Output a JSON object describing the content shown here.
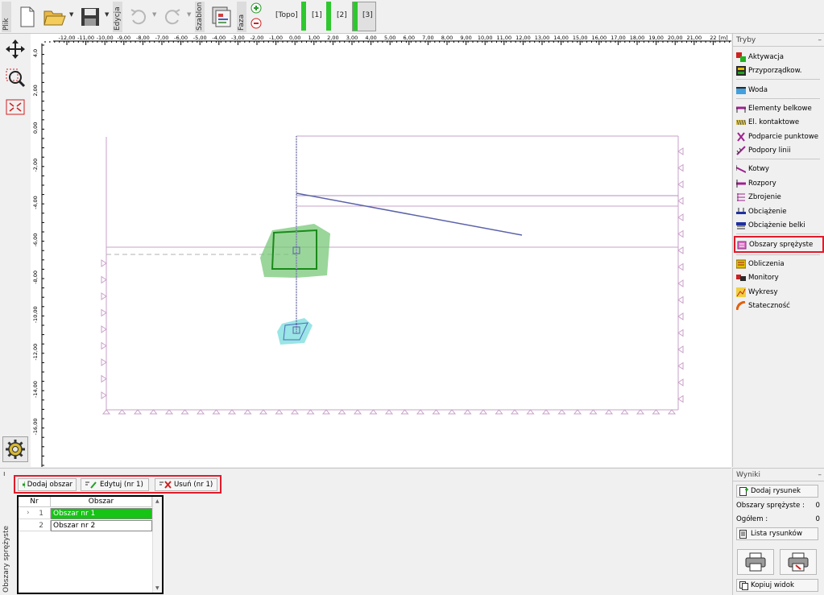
{
  "toolbar": {
    "file_label": "Plik",
    "edit_label": "Edycja",
    "template_label": "Szablon",
    "phase_label": "Faza",
    "phases": [
      "[Topo]",
      "[1]",
      "[2]",
      "[3]"
    ],
    "active_phase": "[3]"
  },
  "ruler": {
    "x_ticks": [
      "-12,00",
      "-11,00",
      "-10,00",
      "-9,00",
      "-8,00",
      "-7,00",
      "-6,00",
      "-5,00",
      "-4,00",
      "-3,00",
      "-2,00",
      "-1,00",
      "0,00",
      "1,00",
      "2,00",
      "3,00",
      "4,00",
      "5,00",
      "6,00",
      "7,00",
      "8,00",
      "9,00",
      "10,00",
      "11,00",
      "12,00",
      "13,00",
      "14,00",
      "15,00",
      "16,00",
      "17,00",
      "18,00",
      "19,00",
      "20,00",
      "21,00",
      "22"
    ],
    "x_unit": "[m]",
    "y_ticks": [
      "4,0",
      "2,00",
      "0,00",
      "-2,00",
      "-4,00",
      "-6,00",
      "-8,00",
      "-10,00",
      "-12,00",
      "-14,00",
      "-16,00"
    ]
  },
  "modes": {
    "title": "Tryby",
    "minimize": "–",
    "items": [
      {
        "label": "Aktywacja",
        "icon": "activation-icon"
      },
      {
        "label": "Przyporządkow.",
        "icon": "assignment-icon"
      },
      {
        "label": "Woda",
        "icon": "water-icon"
      },
      {
        "label": "Elementy belkowe",
        "icon": "beam-elements-icon"
      },
      {
        "label": "El. kontaktowe",
        "icon": "contact-elements-icon"
      },
      {
        "label": "Podparcie punktowe",
        "icon": "point-support-icon"
      },
      {
        "label": "Podpory linii",
        "icon": "line-support-icon"
      },
      {
        "label": "Kotwy",
        "icon": "anchor-icon"
      },
      {
        "label": "Rozpory",
        "icon": "strut-icon"
      },
      {
        "label": "Zbrojenie",
        "icon": "reinforcement-icon"
      },
      {
        "label": "Obciążenie",
        "icon": "load-icon"
      },
      {
        "label": "Obciążenie belki",
        "icon": "beam-load-icon"
      },
      {
        "label": "Obszary sprężyste",
        "icon": "elastic-regions-icon"
      },
      {
        "label": "Obliczenia",
        "icon": "analysis-icon"
      },
      {
        "label": "Monitory",
        "icon": "monitors-icon"
      },
      {
        "label": "Wykresy",
        "icon": "graphs-icon"
      },
      {
        "label": "Stateczność",
        "icon": "stability-icon"
      }
    ]
  },
  "bottom": {
    "panel_title": "Obszary sprężyste",
    "add_button": "Dodaj obszar",
    "edit_button": "Edytuj (nr 1)",
    "delete_button": "Usuń (nr 1)",
    "table": {
      "columns": [
        "Nr",
        "Obszar"
      ],
      "rows": [
        {
          "nr": "1",
          "name": "Obszar nr 1",
          "selected": true
        },
        {
          "nr": "2",
          "name": "Obszar nr 2",
          "selected": false
        }
      ]
    }
  },
  "results": {
    "title": "Wyniki",
    "add_drawing": "Dodaj rysunek",
    "elastic_regions_label": "Obszary sprężyste :",
    "elastic_regions_count": "0",
    "total_label": "Ogółem :",
    "total_count": "0",
    "drawing_list": "Lista rysunków",
    "copy_view": "Kopiuj widok"
  },
  "colors": {
    "accent_red": "#e11b2a",
    "phase_green": "#2ec82e",
    "selection_green": "#16c416",
    "boundary_purple": "#c8a0c8",
    "structure_blue": "#5a62a8",
    "region1_green": "#78c878",
    "region2_cyan": "#78dcdc"
  }
}
